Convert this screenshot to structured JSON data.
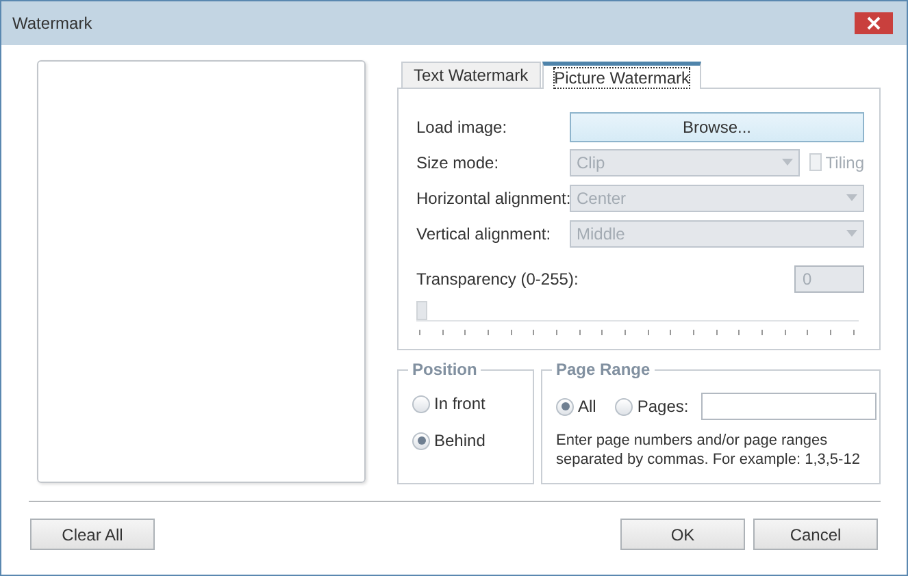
{
  "window": {
    "title": "Watermark"
  },
  "tabs": [
    {
      "label": "Text Watermark",
      "selected": false
    },
    {
      "label": "Picture Watermark",
      "selected": true
    }
  ],
  "picture_settings": {
    "rows": [
      {
        "kind": "button",
        "label": "Load image:",
        "value": "Browse..."
      },
      {
        "kind": "combo",
        "label": "Size mode:",
        "value": "Clip",
        "disabled": true,
        "checkbox": {
          "label": "Tiling",
          "checked": false,
          "disabled": true
        }
      },
      {
        "kind": "combo",
        "label": "Horizontal alignment:",
        "value": "Center",
        "disabled": true
      },
      {
        "kind": "combo",
        "label": "Vertical alignment:",
        "value": "Middle",
        "disabled": true
      }
    ],
    "transparency": {
      "label": "Transparency (0-255):",
      "value": "0",
      "disabled": true,
      "level": 0
    }
  },
  "position": {
    "title": "Position",
    "options": [
      {
        "label": "In front",
        "selected": false
      },
      {
        "label": "Behind",
        "selected": true
      }
    ]
  },
  "page_range": {
    "title": "Page Range",
    "options": [
      {
        "label": "All",
        "selected": true
      },
      {
        "label": "Pages:",
        "selected": false
      }
    ],
    "hint": "Enter page numbers and/or page ranges separated by commas. For example: 1,3,5-12"
  },
  "buttons": {
    "left": [
      "Clear All"
    ],
    "right": [
      "OK",
      "Cancel"
    ]
  }
}
